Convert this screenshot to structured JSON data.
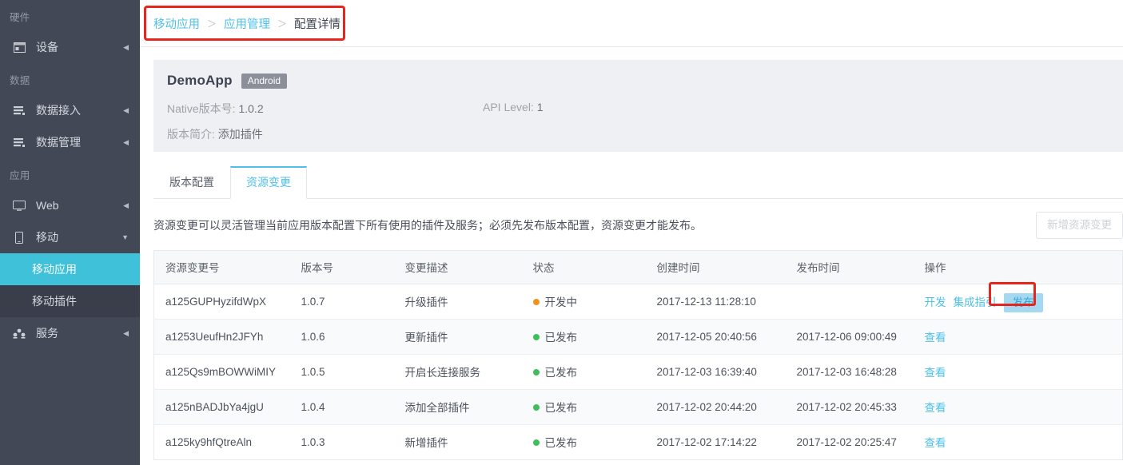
{
  "sidebar": {
    "groups": [
      {
        "label": "硬件",
        "items": [
          {
            "label": "设备",
            "icon": "monitor-window-icon",
            "arrow": "collapsed"
          }
        ]
      },
      {
        "label": "数据",
        "items": [
          {
            "label": "数据接入",
            "icon": "data-list-icon",
            "arrow": "collapsed"
          },
          {
            "label": "数据管理",
            "icon": "data-list-icon",
            "arrow": "collapsed"
          }
        ]
      },
      {
        "label": "应用",
        "items": [
          {
            "label": "Web",
            "icon": "desktop-icon",
            "arrow": "collapsed"
          },
          {
            "label": "移动",
            "icon": "mobile-icon",
            "arrow": "expanded"
          }
        ]
      }
    ],
    "submenu": [
      {
        "label": "移动应用",
        "active": true
      },
      {
        "label": "移动插件",
        "active": false
      }
    ],
    "service_item": {
      "label": "服务",
      "icon": "users-icon",
      "arrow": "collapsed"
    }
  },
  "breadcrumb": {
    "item1": "移动应用",
    "sep1": "＞",
    "item2": "应用管理",
    "sep2": "＞",
    "current": "配置详情"
  },
  "app_card": {
    "name": "DemoApp",
    "platform_badge": "Android",
    "native_version_label": "Native版本号:",
    "native_version_value": "1.0.2",
    "api_level_label": "API Level:",
    "api_level_value": "1",
    "intro_label": "版本简介:",
    "intro_value": "添加插件"
  },
  "tabs": [
    {
      "label": "版本配置",
      "active": false
    },
    {
      "label": "资源变更",
      "active": true
    }
  ],
  "toolbar": {
    "description": "资源变更可以灵活管理当前应用版本配置下所有使用的插件及服务；必须先发布版本配置，资源变更才能发布。",
    "add_button_label": "新增资源变更",
    "add_button_disabled": true
  },
  "table": {
    "columns": [
      "资源变更号",
      "版本号",
      "变更描述",
      "状态",
      "创建时间",
      "发布时间",
      "操作"
    ],
    "rows": [
      {
        "id": "a125GUPHyzifdWpX",
        "version": "1.0.7",
        "description": "升级插件",
        "status": "开发中",
        "status_color": "#f0921e",
        "created": "2017-12-13 11:28:10",
        "published": "",
        "actions": [
          "开发",
          "集成指引"
        ],
        "highlighted_action": "发布"
      },
      {
        "id": "a1253UeufHn2JFYh",
        "version": "1.0.6",
        "description": "更新插件",
        "status": "已发布",
        "status_color": "#3dbf5c",
        "created": "2017-12-05 20:40:56",
        "published": "2017-12-06 09:00:49",
        "actions": [
          "查看"
        ],
        "highlighted_action": ""
      },
      {
        "id": "a125Qs9mBOWWiMIY",
        "version": "1.0.5",
        "description": "开启长连接服务",
        "status": "已发布",
        "status_color": "#3dbf5c",
        "created": "2017-12-03 16:39:40",
        "published": "2017-12-03 16:48:28",
        "actions": [
          "查看"
        ],
        "highlighted_action": ""
      },
      {
        "id": "a125nBADJbYa4jgU",
        "version": "1.0.4",
        "description": "添加全部插件",
        "status": "已发布",
        "status_color": "#3dbf5c",
        "created": "2017-12-02 20:44:20",
        "published": "2017-12-02 20:45:33",
        "actions": [
          "查看"
        ],
        "highlighted_action": ""
      },
      {
        "id": "a125ky9hfQtreAln",
        "version": "1.0.3",
        "description": "新增插件",
        "status": "已发布",
        "status_color": "#3dbf5c",
        "created": "2017-12-02 17:14:22",
        "published": "2017-12-02 20:25:47",
        "actions": [
          "查看"
        ],
        "highlighted_action": ""
      }
    ]
  },
  "annotations": {
    "breadcrumb_box_color": "#e8251c",
    "publish_box_color": "#e8251c"
  },
  "theme": {
    "accent": "#4fc0e8",
    "sidebar_bg": "#434857",
    "sidebar_active": "#3ec1d9",
    "submenu_bg": "#3a3e4a"
  }
}
